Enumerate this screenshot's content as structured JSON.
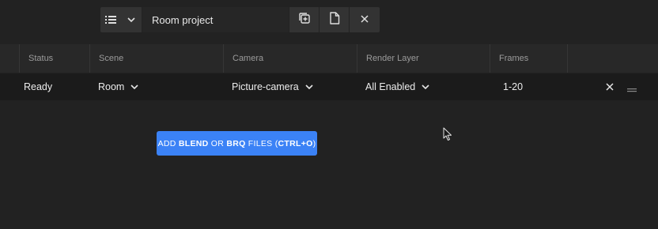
{
  "toolbar": {
    "project_title": "Room project",
    "icons": {
      "list": "list-icon",
      "dropdown": "chevron-down-icon",
      "add_file": "add-file-icon",
      "new_file": "file-icon",
      "close": "close-icon"
    }
  },
  "table": {
    "headers": [
      "Status",
      "Scene",
      "Camera",
      "Render Layer",
      "Frames"
    ],
    "rows": [
      {
        "status": "Ready",
        "scene": "Room",
        "camera": "Picture-camera",
        "render_layer": "All Enabled",
        "frames": "1-20"
      }
    ]
  },
  "add_button": {
    "part1": "ADD ",
    "part2": "BLEND",
    "part3": " OR ",
    "part4": "BRQ",
    "part5": " FILES (",
    "part6": "CTRL+O",
    "part7": ")"
  },
  "colors": {
    "background": "#222222",
    "row": "#1b1b1b",
    "header": "#282828",
    "accent": "#3b82f6"
  }
}
